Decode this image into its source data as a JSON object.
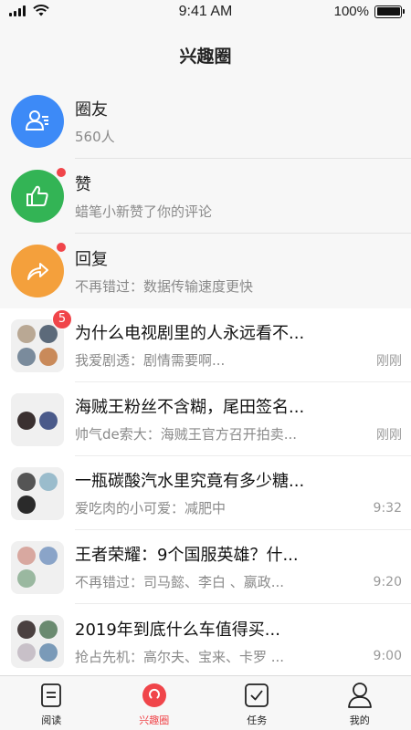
{
  "status": {
    "time": "9:41 AM",
    "battery": "100%",
    "battery_level": 1.0
  },
  "header": {
    "title": "兴趣圈"
  },
  "top_items": [
    {
      "title": "圈友",
      "subtitle": "560人",
      "color": "#3d8af7",
      "icon": "contacts-icon",
      "unread_dot": false
    },
    {
      "title": "赞",
      "subtitle": "蜡笔小新赞了你的评论",
      "color": "#33b455",
      "icon": "thumbs-up-icon",
      "unread_dot": true
    },
    {
      "title": "回复",
      "subtitle": "不再错过：数据传输速度更快",
      "color": "#f4a03c",
      "icon": "reply-arrow-icon",
      "unread_dot": true
    }
  ],
  "chats": [
    {
      "title": "为什么电视剧里的人永远看不...",
      "preview": "我爱剧透：剧情需要啊...",
      "time": "刚刚",
      "badge": "5",
      "avatars": [
        "#b9a894",
        "#5c6a7a",
        "#7a8b9c",
        "#c98a5a"
      ]
    },
    {
      "title": "海贼王粉丝不含糊，尾田签名...",
      "preview": "帅气de索大：海贼王官方召开拍卖...",
      "time": "刚刚",
      "badge": "",
      "avatars": [
        "#3a3030",
        "#4a5a8a"
      ]
    },
    {
      "title": "一瓶碳酸汽水里究竟有多少糖...",
      "preview": "爱吃肉的小可爱：减肥中",
      "time": "9:32",
      "badge": "",
      "avatars": [
        "#555555",
        "#9abccc",
        "#2a2a2a"
      ]
    },
    {
      "title": "王者荣耀：9个国服英雄？什...",
      "preview": "不再错过：司马懿、李白 、嬴政...",
      "time": "9:20",
      "badge": "",
      "avatars": [
        "#d8a8a0",
        "#8aa4c8",
        "#9ab8a0"
      ]
    },
    {
      "title": "2019年到底什么车值得买...",
      "preview": "抢占先机：高尔夫、宝来、卡罗 ...",
      "time": "9:00",
      "badge": "",
      "avatars": [
        "#4a4040",
        "#6a8a70",
        "#c8c0c8",
        "#7a9ab8"
      ]
    }
  ],
  "tabs": [
    {
      "label": "阅读",
      "icon": "book-icon",
      "active": false
    },
    {
      "label": "兴趣圈",
      "icon": "circle-icon",
      "active": true
    },
    {
      "label": "任务",
      "icon": "checkbox-icon",
      "active": false
    },
    {
      "label": "我的",
      "icon": "person-icon",
      "active": false
    }
  ],
  "colors": {
    "accent": "#f0454a",
    "badge": "#f0454a"
  }
}
